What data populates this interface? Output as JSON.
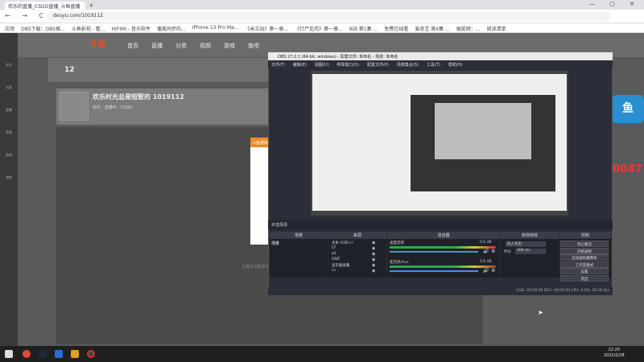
{
  "browser": {
    "tab_title": "欢乐的直播_CSGO直播_斗鱼直播",
    "new_tab": "+",
    "window_controls": "— ▢ ✕",
    "nav": "← → C",
    "url": "douyu.com/1019112",
    "bookmarks": [
      "应用",
      "OBS下载：OBS推...",
      "斗鱼影视 - 看...",
      "HIFIMI - 音乐软件",
      "播客同步的...",
      "iPhone 13 Pro Ma...",
      "《米兰站》第一章...",
      "《行尸走肉》第一章...",
      "B站 第1集 ...",
      "免费在线看",
      "爱奇艺 第4集 ...",
      "抽奖网：...",
      "阅读清单"
    ]
  },
  "site": {
    "logo": "斗鱼",
    "topnav": [
      "首页",
      "直播",
      "分类",
      "视频",
      "游戏",
      "鱼吧"
    ],
    "follow_count": "12",
    "room_title": "欢乐时光总是短暂的 1019112",
    "room_sub": "欢乐 · 直播中 · CSGO",
    "popup_head": "斗鱼通知",
    "loading": "主播正在赶来的路上...",
    "fan_group": "水友群:737140047",
    "side_items": [
      "关注",
      "分类",
      "直播",
      "视频",
      "鱼吧",
      "游戏"
    ]
  },
  "obs": {
    "title": "OBS 27.2.1 (64-bit, windows) - 配置文件: 未命名 - 场景: 未命名",
    "menu": [
      "文件(F)",
      "编辑(E)",
      "视图(V)",
      "停靠窗口(D)",
      "配置文件(P)",
      "场景集合(S)",
      "工具(T)",
      "帮助(H)"
    ],
    "scene_bar": "未选择源",
    "docks": {
      "scenes": "场景",
      "sources": "来源",
      "mixer": "混音器",
      "transitions": "转场特效",
      "controls": "控制"
    },
    "scene_item": "场景",
    "sources": [
      "文本 (GDI+)",
      "CF",
      "p2",
      "GNZ",
      "显示器采集",
      "cs"
    ],
    "mixer": [
      {
        "name": "桌面音频",
        "db": "0.0 dB"
      },
      {
        "name": "麦克风/Aux",
        "db": "0.0 dB"
      }
    ],
    "transition": "淡入淡出",
    "duration_label": "时长",
    "duration": "300 ms",
    "controls": [
      "停止推流",
      "开始录制",
      "启动虚拟摄像机",
      "工作室模式",
      "设置",
      "退出"
    ],
    "status": "LIVE: 00:00:00   REC: 00:00:00   CPU: 0.9%, 60.00 fps"
  },
  "taskbar": {
    "time": "22:25",
    "date": "2022/2/28"
  }
}
